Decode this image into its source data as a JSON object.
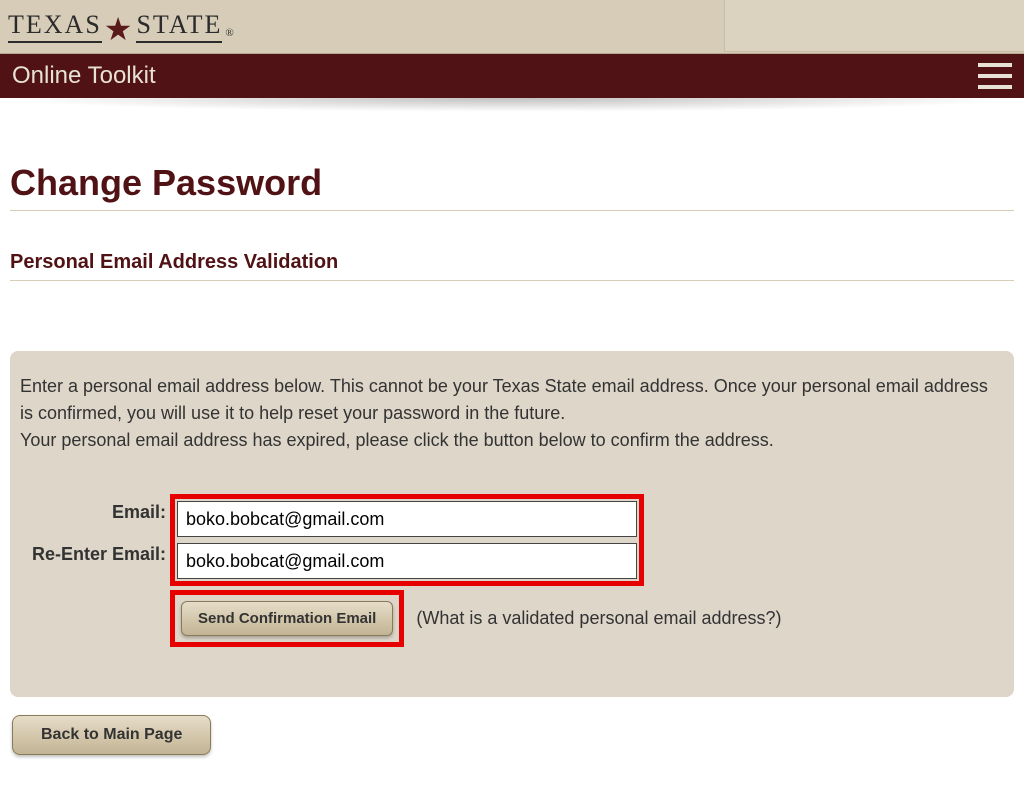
{
  "header": {
    "logo_left": "TEXAS",
    "logo_right": "STATE",
    "reg": "®",
    "app_title": "Online Toolkit"
  },
  "page": {
    "title": "Change Password",
    "section": "Personal Email Address Validation"
  },
  "panel": {
    "instruction1": "Enter a personal email address below. This cannot be your Texas State email address. Once your personal email address is confirmed, you will use it to help reset your password in the future.",
    "instruction2": "Your personal email address has expired, please click the button below to confirm the address."
  },
  "form": {
    "email_label": "Email:",
    "reenter_label": "Re-Enter Email:",
    "email_value": "boko.bobcat@gmail.com",
    "reenter_value": "boko.bobcat@gmail.com",
    "send_button": "Send Confirmation Email",
    "help_text": "(What is a validated personal email address?)"
  },
  "footer": {
    "back_button": "Back to Main Page"
  }
}
